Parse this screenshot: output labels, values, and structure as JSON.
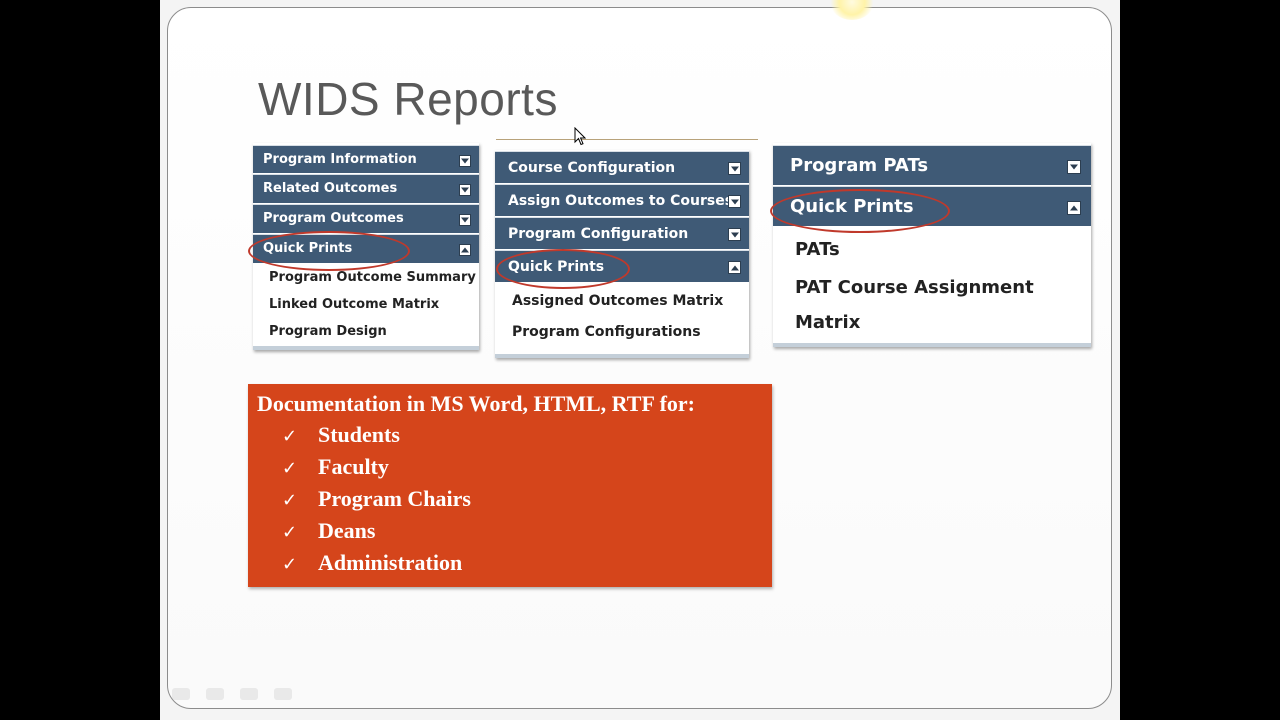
{
  "slide": {
    "title": "WIDS Reports"
  },
  "panel_left": {
    "menu_items": [
      {
        "label": "Program Information",
        "toggle": "down"
      },
      {
        "label": "Related Outcomes",
        "toggle": "down"
      },
      {
        "label": "Program Outcomes",
        "toggle": "down"
      },
      {
        "label": "Quick Prints",
        "toggle": "up"
      }
    ],
    "sub_items": [
      "Program Outcome Summary",
      "Linked Outcome Matrix",
      "Program Design"
    ]
  },
  "panel_middle": {
    "menu_items": [
      {
        "label": "Course Configuration",
        "toggle": "down"
      },
      {
        "label": "Assign Outcomes to Courses",
        "toggle": "down"
      },
      {
        "label": "Program Configuration",
        "toggle": "down"
      },
      {
        "label": "Quick Prints",
        "toggle": "up"
      }
    ],
    "sub_items": [
      "Assigned Outcomes Matrix",
      "Program Configurations"
    ]
  },
  "panel_right": {
    "menu_items": [
      {
        "label": "Program PATs",
        "toggle": "down"
      },
      {
        "label": "Quick Prints",
        "toggle": "up"
      }
    ],
    "sub_items": [
      "PATs",
      "PAT Course Assignment",
      "Matrix"
    ]
  },
  "documentation": {
    "heading": "Documentation in MS Word, HTML, RTF for:",
    "check_glyph": "✓",
    "audiences": [
      "Students",
      "Faculty",
      "Program Chairs",
      "Deans",
      "Administration"
    ]
  },
  "colors": {
    "menu_header": "#3f5a76",
    "highlight_ellipse": "#c0392b",
    "doc_box": "#d5451b"
  }
}
